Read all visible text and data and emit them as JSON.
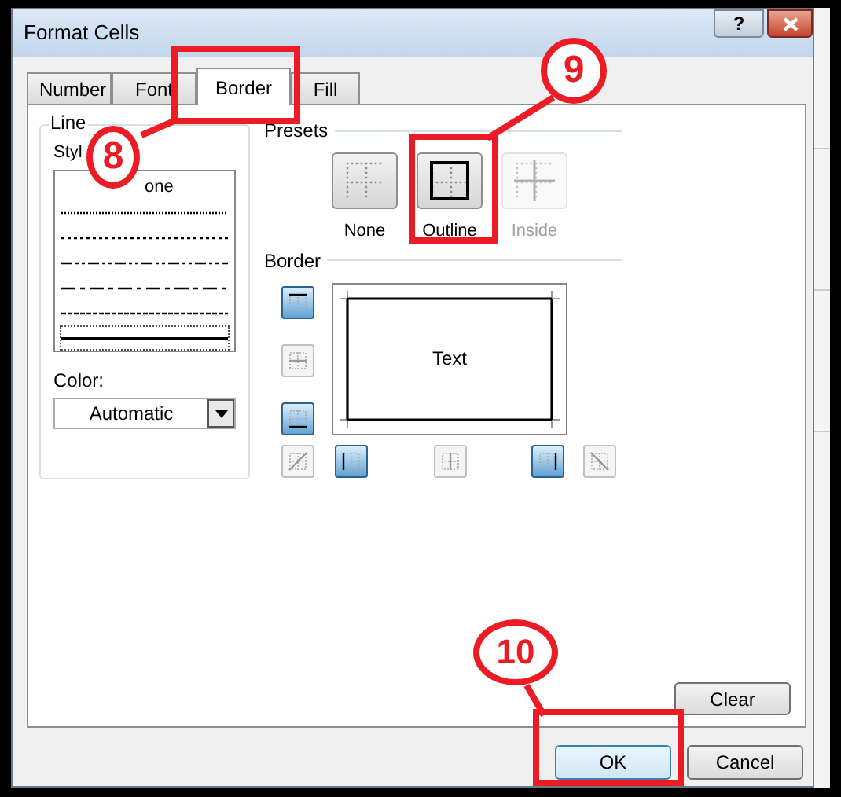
{
  "window": {
    "title": "Format Cells",
    "help": "?"
  },
  "tabs": [
    {
      "label": "Number",
      "selected": false
    },
    {
      "label": "Font",
      "selected": false
    },
    {
      "label": "Border",
      "selected": true
    },
    {
      "label": "Fill",
      "selected": false
    }
  ],
  "line": {
    "title": "Line",
    "style_label": "Styl",
    "styles": [
      {
        "kind": "none",
        "label": "one",
        "selected": false
      },
      {
        "kind": "hair",
        "selected": false
      },
      {
        "kind": "dotted",
        "selected": false
      },
      {
        "kind": "dash_dot_dot",
        "selected": false
      },
      {
        "kind": "dash_dot",
        "selected": false
      },
      {
        "kind": "dashed",
        "selected": false
      },
      {
        "kind": "thin",
        "selected": true
      }
    ],
    "color_label": "Color:",
    "color_value": "Automatic"
  },
  "presets": {
    "title": "Presets",
    "items": [
      {
        "kind": "none",
        "label": "None",
        "disabled": false
      },
      {
        "kind": "outline",
        "label": "Outline",
        "disabled": false
      },
      {
        "kind": "inside",
        "label": "Inside",
        "disabled": true
      }
    ]
  },
  "border": {
    "title": "Border",
    "preview_text": "Text",
    "buttons": [
      {
        "kind": "top",
        "on": true
      },
      {
        "kind": "middle_h",
        "on": false
      },
      {
        "kind": "bottom",
        "on": true
      },
      {
        "kind": "diag_up",
        "on": false
      },
      {
        "kind": "left",
        "on": true
      },
      {
        "kind": "middle_v",
        "on": false
      },
      {
        "kind": "right",
        "on": true
      },
      {
        "kind": "diag_down",
        "on": false
      }
    ]
  },
  "clear_button": "Clear",
  "buttons": [
    {
      "label": "OK",
      "default": true
    },
    {
      "label": "Cancel",
      "default": false
    }
  ],
  "annotations": [
    {
      "label": "8"
    },
    {
      "label": "9"
    },
    {
      "label": "10"
    }
  ]
}
